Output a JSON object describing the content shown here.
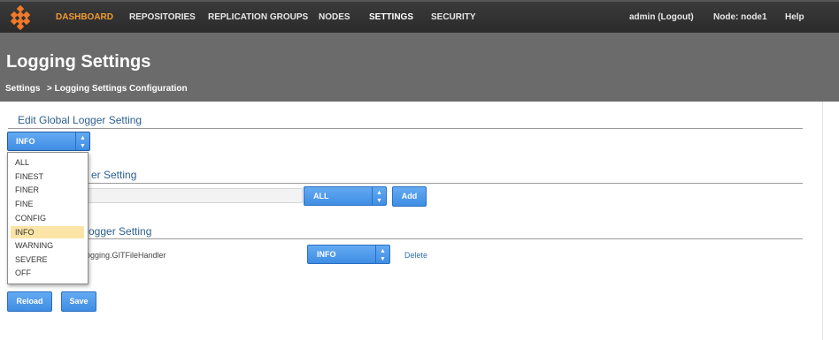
{
  "colors": {
    "accent": "#f29b31",
    "topbar": "#2b2b2b",
    "header": "#6b6b6b",
    "button": "#3f8de3",
    "highlight": "#fbe4a6"
  },
  "nav": {
    "logo_icon": "diamond-logo-icon",
    "items": [
      "DASHBOARD",
      "REPOSITORIES",
      "REPLICATION GROUPS",
      "NODES",
      "SETTINGS",
      "SECURITY"
    ],
    "user": "admin (Logout)",
    "node": "Node: node1",
    "help": "Help"
  },
  "header": {
    "title": "Logging Settings",
    "breadcrumb": [
      "Settings",
      "> Logging Settings Configuration"
    ]
  },
  "global_logger": {
    "title": "Edit Global Logger Setting",
    "selected": "INFO",
    "options": [
      "ALL",
      "FINEST",
      "FINER",
      "FINE",
      "CONFIG",
      "INFO",
      "WARNING",
      "SEVERE",
      "OFF"
    ]
  },
  "add_logger": {
    "title_visible": "er Setting",
    "level": "ALL",
    "add_label": "Add"
  },
  "edit_logger": {
    "title_visible": "ogger Setting",
    "handler_visible": "s.logging.GITFileHandler",
    "level": "INFO",
    "delete_label": "Delete"
  },
  "actions": {
    "reload_label": "Reload",
    "save_label": "Save"
  }
}
